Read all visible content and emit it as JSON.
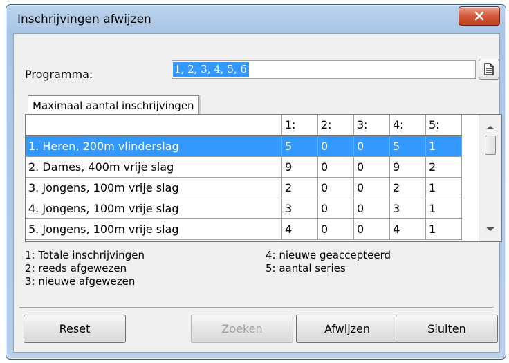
{
  "window": {
    "title": "Inschrijvingen afwijzen"
  },
  "programma": {
    "label": "Programma:",
    "value": "1, 2, 3, 4, 5, 6"
  },
  "tab": {
    "label": "Maximaal aantal inschrijvingen"
  },
  "table": {
    "columns": [
      "",
      "1:",
      "2:",
      "3:",
      "4:",
      "5:"
    ],
    "rows": [
      {
        "name": "1. Heren, 200m vlinderslag",
        "c1": "5",
        "c2": "0",
        "c3": "0",
        "c4": "5",
        "c5": "1"
      },
      {
        "name": "2. Dames, 400m vrije slag",
        "c1": "9",
        "c2": "0",
        "c3": "0",
        "c4": "9",
        "c5": "2"
      },
      {
        "name": "3. Jongens, 100m vrije slag",
        "c1": "2",
        "c2": "0",
        "c3": "0",
        "c4": "2",
        "c5": "1"
      },
      {
        "name": "4. Jongens, 100m vrije slag",
        "c1": "3",
        "c2": "0",
        "c3": "0",
        "c4": "3",
        "c5": "1"
      },
      {
        "name": "5. Jongens, 100m vrije slag",
        "c1": "4",
        "c2": "0",
        "c3": "0",
        "c4": "4",
        "c5": "1"
      }
    ],
    "selected_row": 0
  },
  "legend": {
    "l1": "1: Totale inschrijvingen",
    "l2": "2: reeds afgewezen",
    "l3": "3: nieuwe afgewezen",
    "l4": "4: nieuwe geaccepteerd",
    "l5": "5: aantal series"
  },
  "buttons": {
    "reset": "Reset",
    "zoeken": "Zoeken",
    "afwijzen": "Afwijzen",
    "sluiten": "Sluiten"
  },
  "colors": {
    "selection": "#3399ff",
    "close_button": "#c13d1c"
  },
  "icons": {
    "close": "close-icon",
    "document": "document-icon"
  }
}
